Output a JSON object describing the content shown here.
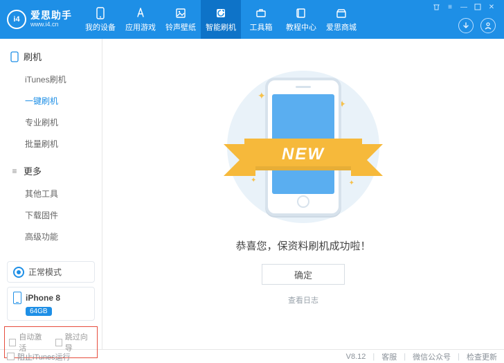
{
  "header": {
    "logo": {
      "badge": "i4",
      "title": "爱思助手",
      "subtitle": "www.i4.cn"
    },
    "tabs": [
      {
        "label": "我的设备",
        "icon": "phone"
      },
      {
        "label": "应用游戏",
        "icon": "apps"
      },
      {
        "label": "铃声壁纸",
        "icon": "media"
      },
      {
        "label": "智能刷机",
        "icon": "flash",
        "active": true
      },
      {
        "label": "工具箱",
        "icon": "toolbox"
      },
      {
        "label": "教程中心",
        "icon": "book"
      },
      {
        "label": "爱思商城",
        "icon": "shop"
      }
    ]
  },
  "sidebar": {
    "sections": [
      {
        "title": "刷机",
        "icon": "phone-outline",
        "items": [
          {
            "label": "iTunes刷机"
          },
          {
            "label": "一键刷机",
            "active": true
          },
          {
            "label": "专业刷机"
          },
          {
            "label": "批量刷机"
          }
        ]
      },
      {
        "title": "更多",
        "icon": "more",
        "items": [
          {
            "label": "其他工具"
          },
          {
            "label": "下载固件"
          },
          {
            "label": "高级功能"
          }
        ]
      }
    ],
    "mode": {
      "label": "正常模式"
    },
    "device": {
      "name": "iPhone 8",
      "storage": "64GB"
    },
    "footer_checks": [
      {
        "label": "自动激活"
      },
      {
        "label": "跳过向导"
      }
    ]
  },
  "main": {
    "ribbon": "NEW",
    "success_text": "恭喜您，保资料刷机成功啦！",
    "ok_button": "确定",
    "log_link": "查看日志"
  },
  "statusbar": {
    "left_checkbox": "阻止iTunes运行",
    "version": "V8.12",
    "links": [
      "客服",
      "微信公众号",
      "检查更新"
    ]
  }
}
